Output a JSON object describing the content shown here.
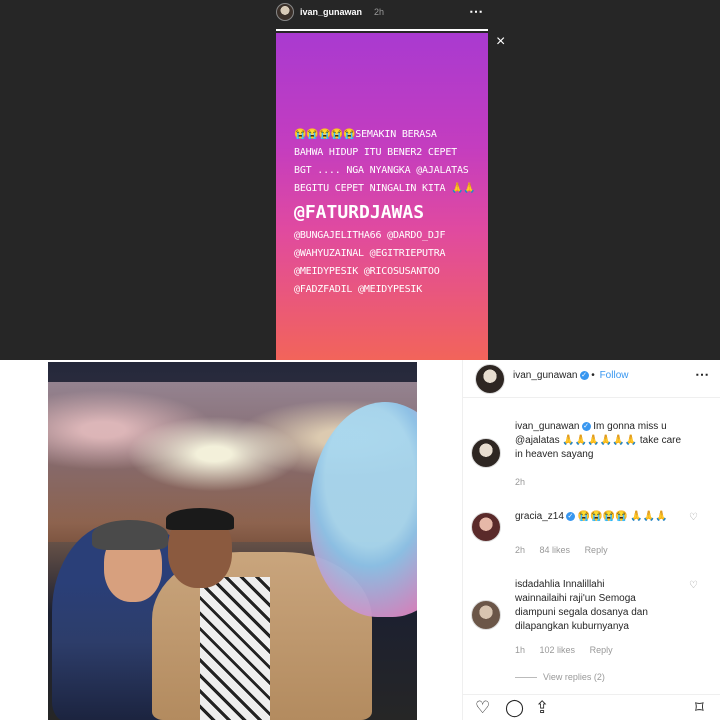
{
  "story": {
    "username": "ivan_gunawan",
    "time": "2h",
    "more_icon": "⋯",
    "close_icon": "×",
    "progress": 1.0,
    "text": {
      "line1_emoji": "😭😭😭😭😭",
      "line1": "SEMAKIN BERASA",
      "line2": "BAHWA HIDUP ITU BENER2 CEPET",
      "line3": "BGT .... NGA NYANGKA @AJALATAS",
      "line4": "BEGITU CEPET NINGALIN KITA",
      "line4_emoji": "🙏🙏",
      "big_mention": "@FATURDJAWAS",
      "mentions": [
        "@BUNGAJELITHA66 @DARDO_DJF",
        "@WAHYUZAINAL @EGITRIEPUTRA",
        "@MEIDYPESIK @RICOSUSANTOO",
        "@FADZFADIL @MEIDYPESIK"
      ]
    }
  },
  "post": {
    "username": "ivan_gunawan",
    "follow_label": "Follow",
    "separator": "•",
    "comments": [
      {
        "user": "ivan_gunawan",
        "text_a": "Im gonna miss u",
        "text_b": "@ajalatas",
        "hands": "🙏🙏🙏🙏🙏🙏",
        "text_c": "take care",
        "text_d": "in heaven sayang",
        "time": "2h"
      },
      {
        "user": "gracia_z14",
        "emoji": "😭😭😭😭",
        "hands": "🙏🙏🙏",
        "time": "2h",
        "likes": "84 likes",
        "reply": "Reply"
      },
      {
        "user": "isdadahlia",
        "text_a": "Innalillahi",
        "text_b": "wainnailaihi raji'un Semoga",
        "text_c": "diampuni segala dosanya dan",
        "text_d": "dilapangkan kuburnyanya",
        "time": "1h",
        "likes": "102 likes",
        "reply": "Reply"
      }
    ],
    "view_replies": "View replies (2)"
  },
  "icons": {
    "heart": "♡",
    "comment": "◯",
    "share": "⇪",
    "bookmark": "⌑"
  }
}
